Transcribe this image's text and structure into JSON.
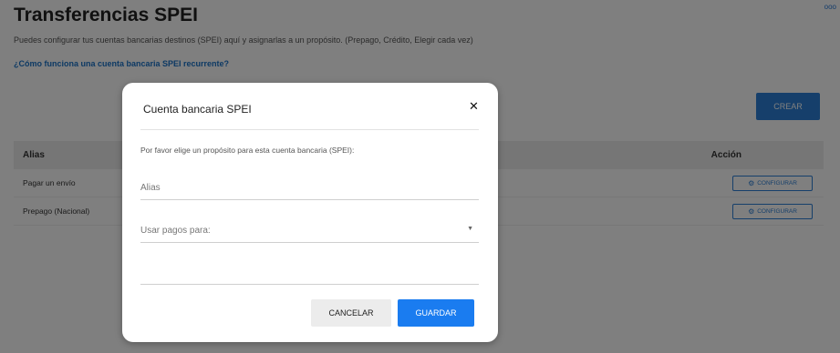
{
  "page": {
    "title": "Transferencias SPEI",
    "description": "Puedes configurar tus cuentas bancarias destinos (SPEI) aquí y asignarlas a un propósito. (Prepago, Crédito, Elegir cada vez)",
    "help_link": "¿Cómo funciona una cuenta bancaria SPEI recurrente?",
    "more_icon": "ooo",
    "create_label": "CREAR"
  },
  "table": {
    "columns": [
      "Alias",
      "Acción"
    ],
    "rows": [
      {
        "alias": "Pagar un envío",
        "action": "CONFIGURAR"
      },
      {
        "alias": "Prepago (Nacional)",
        "action": "CONFIGURAR"
      }
    ]
  },
  "modal": {
    "title": "Cuenta bancaria SPEI",
    "close_icon": "✕",
    "prompt": "Por favor elige un propósito para esta cuenta bancaria (SPEI):",
    "alias_placeholder": "Alias",
    "uso_placeholder": "Usar pagos para:",
    "cancel_label": "CANCELAR",
    "save_label": "GUARDAR"
  },
  "colors": {
    "accent": "#2c7fd6",
    "primary_button": "#1a7cf0",
    "overlay": "rgba(0,0,0,0.5)"
  }
}
